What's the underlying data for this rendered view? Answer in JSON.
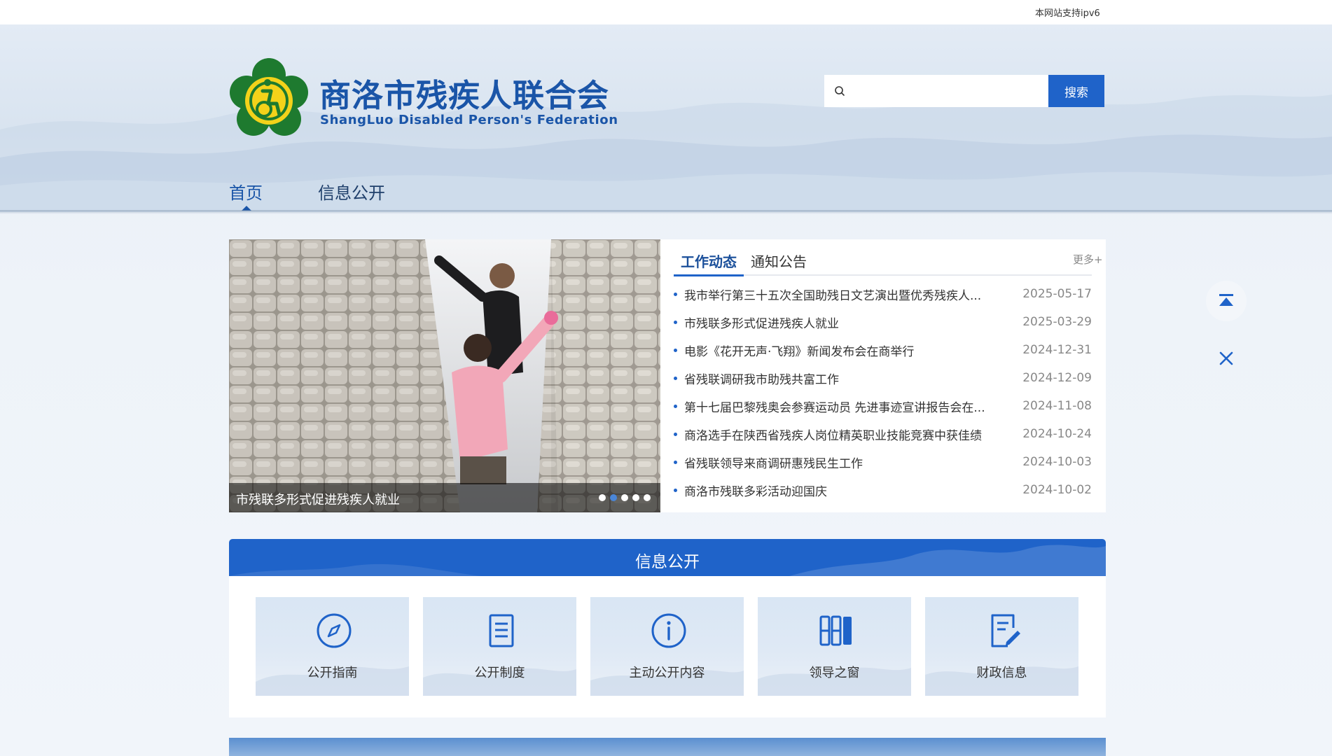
{
  "topbar": {
    "ipv6_text": "本网站支持ipv6"
  },
  "header": {
    "title": "商洛市残疾人联合会",
    "subtitle": "ShangLuo Disabled Person's Federation",
    "search": {
      "placeholder": "",
      "button_label": "搜索"
    }
  },
  "nav": {
    "items": [
      {
        "label": "首页",
        "active": true
      },
      {
        "label": "信息公开",
        "active": false
      }
    ]
  },
  "slider": {
    "caption": "市残联多形式促进残疾人就业",
    "dot_count": 5,
    "active_dot": 1
  },
  "news": {
    "tabs": [
      {
        "label": "工作动态",
        "active": true
      },
      {
        "label": "通知公告",
        "active": false
      }
    ],
    "more_label": "更多+",
    "items": [
      {
        "title": "我市举行第三十五次全国助残日文艺演出暨优秀残疾人...",
        "date": "2025-05-17"
      },
      {
        "title": "市残联多形式促进残疾人就业",
        "date": "2025-03-29"
      },
      {
        "title": "电影《花开无声·飞翔》新闻发布会在商举行",
        "date": "2024-12-31"
      },
      {
        "title": "省残联调研我市助残共富工作",
        "date": "2024-12-09"
      },
      {
        "title": "第十七届巴黎残奥会参赛运动员 先进事迹宣讲报告会在...",
        "date": "2024-11-08"
      },
      {
        "title": "商洛选手在陕西省残疾人岗位精英职业技能竞赛中获佳绩",
        "date": "2024-10-24"
      },
      {
        "title": "省残联领导来商调研惠残民生工作",
        "date": "2024-10-03"
      },
      {
        "title": "商洛市残联多彩活动迎国庆",
        "date": "2024-10-02"
      }
    ]
  },
  "info_section": {
    "title": "信息公开",
    "cards": [
      {
        "label": "公开指南",
        "icon": "compass-icon"
      },
      {
        "label": "公开制度",
        "icon": "document-icon"
      },
      {
        "label": "主动公开内容",
        "icon": "info-icon"
      },
      {
        "label": "领导之窗",
        "icon": "books-icon"
      },
      {
        "label": "财政信息",
        "icon": "edit-document-icon"
      }
    ]
  },
  "colors": {
    "primary": "#1f63c9",
    "title_blue": "#1a55a8",
    "logo_green": "#1e7a2f",
    "logo_yellow": "#f3d21a"
  }
}
